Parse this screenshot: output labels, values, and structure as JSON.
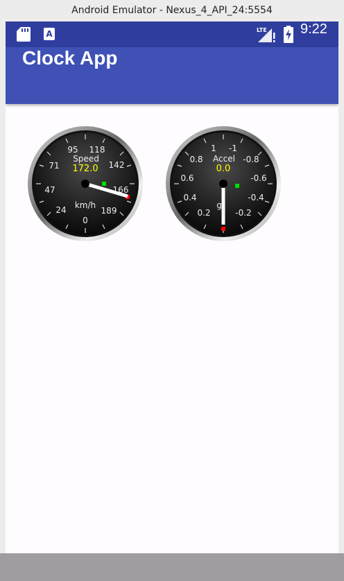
{
  "window": {
    "title": "Android Emulator - Nexus_4_API_24:5554"
  },
  "status_bar": {
    "icons": [
      "sd-card-icon",
      "a-notification-icon",
      "lte-signal-icon",
      "battery-charging-icon"
    ],
    "network_label": "LTE",
    "a_icon_label": "A",
    "time": "9:22",
    "color": "#2f3e9e"
  },
  "app_bar": {
    "title": "Clock App",
    "color": "#3f51b5"
  },
  "gauges": [
    {
      "title": "Speed",
      "value_text": "172.0",
      "unit": "km/h",
      "value": 172.0,
      "ticks": [
        "0",
        "24",
        "47",
        "71",
        "95",
        "118",
        "142",
        "166",
        "189"
      ],
      "min": 0,
      "max": 189
    },
    {
      "title": "Accel",
      "value_text": "0.0",
      "unit": "g",
      "value": 0.0,
      "ticks": [
        "0.2",
        "0.4",
        "0.6",
        "0.8",
        "1",
        "-1",
        "-0.8",
        "-0.6",
        "-0.4",
        "-0.2"
      ]
    }
  ],
  "colors": {
    "value_text": "#ffff00",
    "needle": "#ffffff",
    "marker_low": "#ff0000",
    "marker_high": "#00e000"
  }
}
